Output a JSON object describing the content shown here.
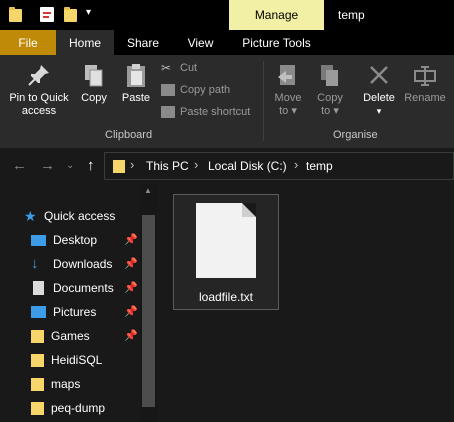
{
  "window": {
    "title": "temp",
    "contextual_tab": "Manage"
  },
  "tabs": {
    "file": "File",
    "home": "Home",
    "share": "Share",
    "view": "View",
    "picture_tools": "Picture Tools"
  },
  "ribbon": {
    "clipboard": {
      "label": "Clipboard",
      "pin_line1": "Pin to Quick",
      "pin_line2": "access",
      "copy": "Copy",
      "paste": "Paste",
      "cut": "Cut",
      "copy_path": "Copy path",
      "paste_shortcut": "Paste shortcut"
    },
    "organise": {
      "label": "Organise",
      "move_to": "Move",
      "move_to_2": "to",
      "copy_to": "Copy",
      "copy_to_2": "to",
      "delete": "Delete",
      "rename": "Rename"
    }
  },
  "address": {
    "crumbs": [
      "This PC",
      "Local Disk (C:)",
      "temp"
    ]
  },
  "nav": {
    "items": [
      {
        "label": "Quick access",
        "icon": "star-icon",
        "pinned": false
      },
      {
        "label": "Desktop",
        "icon": "desktop-icon",
        "pinned": true
      },
      {
        "label": "Downloads",
        "icon": "download-icon",
        "pinned": true
      },
      {
        "label": "Documents",
        "icon": "documents-icon",
        "pinned": true
      },
      {
        "label": "Pictures",
        "icon": "pictures-icon",
        "pinned": true
      },
      {
        "label": "Games",
        "icon": "folder-icon",
        "pinned": true
      },
      {
        "label": "HeidiSQL",
        "icon": "folder-icon",
        "pinned": false
      },
      {
        "label": "maps",
        "icon": "folder-icon",
        "pinned": false
      },
      {
        "label": "peq-dump",
        "icon": "folder-icon",
        "pinned": false
      }
    ]
  },
  "files": [
    {
      "name": "loadfile.txt",
      "type": "text-document"
    }
  ],
  "colors": {
    "file_tab": "#bf8a08",
    "manage_tab": "#f1f0a4",
    "accent_blue": "#3c9ce8",
    "folder": "#f6d66b"
  }
}
